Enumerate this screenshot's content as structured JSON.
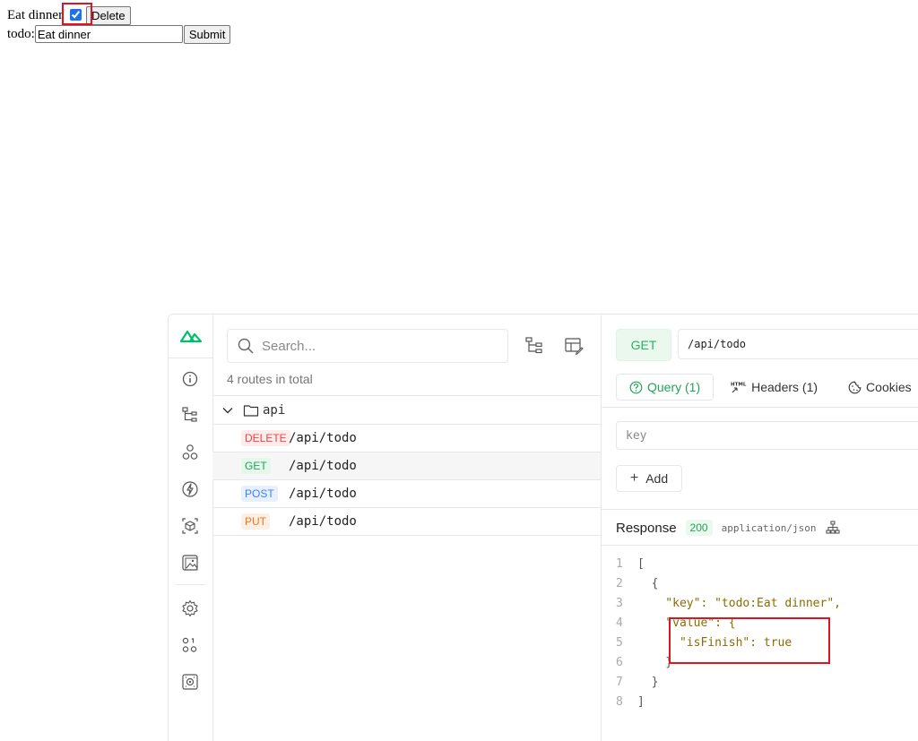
{
  "todo": {
    "item_label": "Eat dinner",
    "item_checked": true,
    "delete_label": "Delete",
    "form_label": "todo:",
    "input_value": "Eat dinner",
    "submit_label": "Submit"
  },
  "devtools": {
    "search_placeholder": "Search...",
    "route_count": "4 routes in total",
    "folder_name": "api",
    "routes": [
      {
        "method": "DELETE",
        "path": "/api/todo"
      },
      {
        "method": "GET",
        "path": "/api/todo"
      },
      {
        "method": "POST",
        "path": "/api/todo"
      },
      {
        "method": "PUT",
        "path": "/api/todo"
      }
    ],
    "request": {
      "method": "GET",
      "url": "/api/todo",
      "tabs": [
        "Query (1)",
        "Headers (1)",
        "Cookies"
      ],
      "key_placeholder": "key",
      "add_label": "Add"
    },
    "response": {
      "title": "Response",
      "status": "200",
      "content_type": "application/json",
      "lines": [
        {
          "n": "1",
          "text": "["
        },
        {
          "n": "2",
          "text": "  {"
        },
        {
          "n": "3",
          "text": "    \"key\": \"todo:Eat dinner\","
        },
        {
          "n": "4",
          "text": "    \"value\": {"
        },
        {
          "n": "5",
          "text": "      \"isFinish\": true"
        },
        {
          "n": "6",
          "text": "    }"
        },
        {
          "n": "7",
          "text": "  }"
        },
        {
          "n": "8",
          "text": "]"
        }
      ]
    }
  },
  "colors": {
    "accent_green": "#22a35b",
    "annotation_red": "#e0141e"
  }
}
